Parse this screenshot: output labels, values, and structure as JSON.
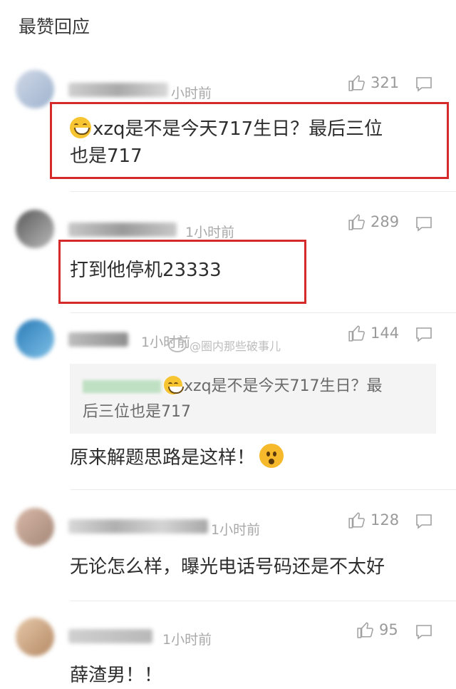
{
  "section_title": "最赞回应",
  "comments": [
    {
      "time": "小时前",
      "likes": "321",
      "text_line1": "xzq是不是今天717生日？最后三位",
      "text_line2": "也是717"
    },
    {
      "time": "1小时前",
      "likes": "289",
      "text": "打到他停机23333"
    },
    {
      "time": "1小时前",
      "likes": "144",
      "quote_line1": "xzq是不是今天717生日？最",
      "quote_line2": "后三位也是717",
      "text": "原来解题思路是这样！"
    },
    {
      "time": "1小时前",
      "likes": "128",
      "text": "无论怎么样，曝光电话号码还是不太好"
    },
    {
      "time": "1小时前",
      "likes": "95",
      "text": "薛渣男！！"
    }
  ],
  "watermark": "@圈内那些破事儿",
  "colors": {
    "highlight_border": "#d42a2a",
    "muted": "#a8a8a8"
  },
  "icons": {
    "like": "thumbs-up-icon",
    "reply": "comment-bubble-icon"
  }
}
